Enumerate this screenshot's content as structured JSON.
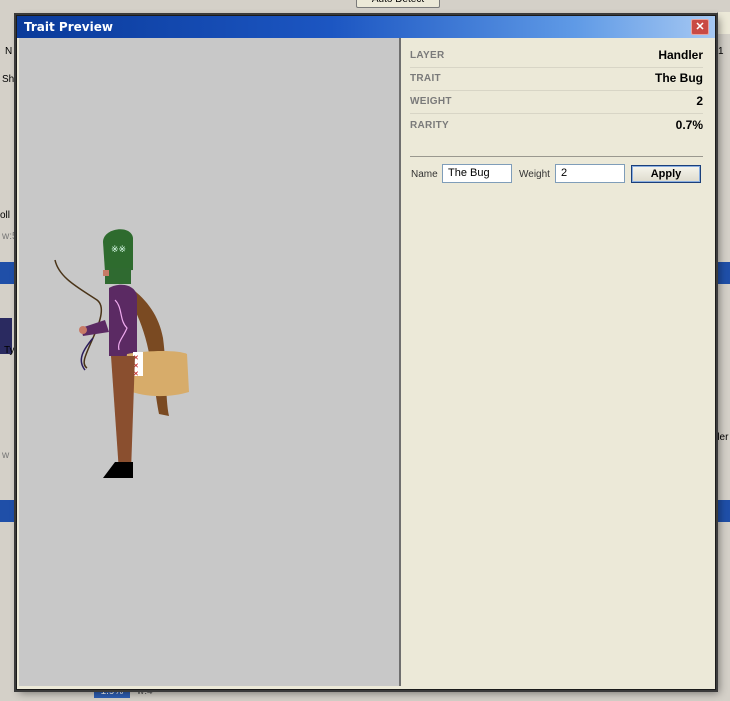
{
  "background_app": {
    "top_button": "Auto Detect",
    "fragments": {
      "n": "N",
      "sh": "Sh",
      "oll": "oll",
      "w5": "w:5",
      "ty": "Ty",
      "w": "w",
      "der": "der",
      "one": "1",
      "percent_chip": "1.9%",
      "w4": "w:4"
    }
  },
  "dialog": {
    "title": "Trait Preview",
    "close_icon": "close-icon",
    "details": [
      {
        "key": "LAYER",
        "value": "Handler"
      },
      {
        "key": "TRAIT",
        "value": "The Bug"
      },
      {
        "key": "WEIGHT",
        "value": "2"
      },
      {
        "key": "RARITY",
        "value": "0.7%"
      }
    ],
    "form": {
      "name_label": "Name",
      "name_value": "The Bug",
      "weight_label": "Weight",
      "weight_value": "2",
      "apply_label": "Apply"
    },
    "colors": {
      "title_gradient_start": "#0a3a9a",
      "title_gradient_end": "#a6c8f2",
      "preview_bg": "#c8c8c8",
      "panel_bg": "#ece9d8",
      "close_button": "#c94a44"
    },
    "preview_image": "character-with-whip-figure"
  }
}
